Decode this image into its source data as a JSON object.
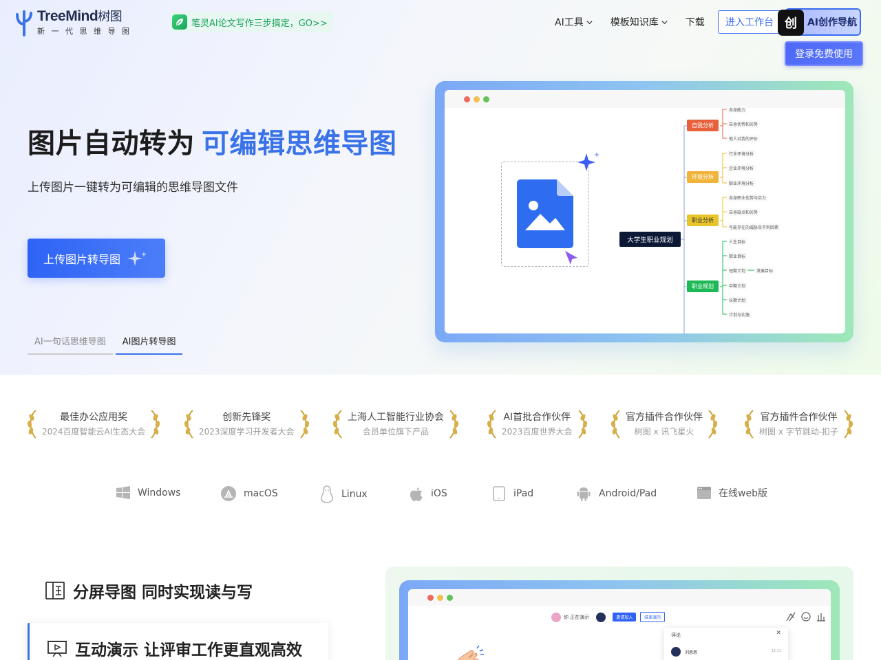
{
  "header": {
    "logo_name": "TreeMind",
    "logo_name_cn": "树图",
    "logo_tagline": "新一代思维导图",
    "promo_text": "笔灵AI论文写作三步搞定，GO>>",
    "nav": [
      {
        "label": "AI工具",
        "has_dropdown": true
      },
      {
        "label": "模板知识库",
        "has_dropdown": true
      },
      {
        "label": "下载",
        "has_dropdown": false
      }
    ],
    "workspace_button": "进入工作台",
    "ai_badge": "创",
    "ai_nav_label": "AI创作导航",
    "login_button": "登录免费使用"
  },
  "hero": {
    "title_plain": "图片自动转为",
    "title_highlight": "可编辑思维导图",
    "subtitle": "上传图片一键转为可编辑的思维导图文件",
    "upload_button": "上传图片转导图",
    "tabs": [
      {
        "label": "AI一句话思维导图",
        "active": false
      },
      {
        "label": "AI图片转导图",
        "active": true
      }
    ]
  },
  "mindmap": {
    "root": "大学生职业规划",
    "branches": [
      {
        "label": "自我分析",
        "color": "#e8613c",
        "leaves": [
          "自身能力",
          "自身优势和劣势",
          "他人对我的评价"
        ]
      },
      {
        "label": "环境分析",
        "color": "#f0b43a",
        "leaves": [
          "行业环境分析",
          "企业环境分析",
          "职业环境分析"
        ]
      },
      {
        "label": "职业分析",
        "color": "#e8c52a",
        "leaves": [
          "自身职业优势与实力",
          "自身缺点和劣势",
          "可能存在的威胁及不利因素"
        ]
      },
      {
        "label": "职业规划",
        "color": "#1db954",
        "leaves": [
          "人生目标",
          "职业目标",
          "短期计划",
          "中期计划",
          "长期计划",
          "计划与实施"
        ]
      }
    ],
    "extra_leaf": "发展目标"
  },
  "awards": [
    {
      "title": "最佳办公应用奖",
      "sub": "2024百度智能云AI生态大会"
    },
    {
      "title": "创新先锋奖",
      "sub": "2023深度学习开发者大会"
    },
    {
      "title": "上海人工智能行业协会",
      "sub": "会员单位旗下产品"
    },
    {
      "title": "AI首批合作伙伴",
      "sub": "2023百度世界大会"
    },
    {
      "title": "官方插件合作伙伴",
      "sub": "树图 x 讯飞星火"
    },
    {
      "title": "官方插件合作伙伴",
      "sub": "树图 x 字节跳动-扣子"
    }
  ],
  "platforms": [
    {
      "label": "Windows",
      "icon": "windows-icon"
    },
    {
      "label": "macOS",
      "icon": "appstore-icon"
    },
    {
      "label": "Linux",
      "icon": "linux-icon"
    },
    {
      "label": "iOS",
      "icon": "apple-icon"
    },
    {
      "label": "iPad",
      "icon": "ipad-icon"
    },
    {
      "label": "Android/Pad",
      "icon": "android-icon"
    },
    {
      "label": "在线web版",
      "icon": "browser-icon"
    }
  ],
  "features": {
    "split_screen": "分屏导图 同时实现读与写",
    "presentation": "互动演示 让评审工作更直观高效"
  },
  "demo": {
    "presenting_text": "你 正在演示",
    "invite_button": "邀请加入",
    "end_button": "结束演示",
    "comment_title": "评论",
    "comment_user": "刘思思",
    "comment_time": "12:11"
  },
  "colors": {
    "brand_blue": "#3a72e8",
    "button_blue": "#2e63f5",
    "promo_green": "#1aa35b"
  }
}
